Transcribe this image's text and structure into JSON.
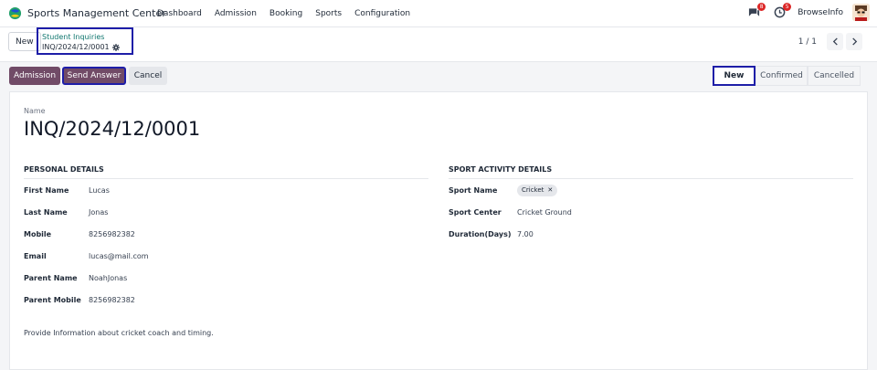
{
  "navbar": {
    "app_name": "Sports Management Center",
    "menu": [
      "Dashboard",
      "Admission",
      "Booking",
      "Sports",
      "Configuration"
    ],
    "chat_badge": "8",
    "activity_badge": "5",
    "company": "BrowseInfo"
  },
  "control": {
    "new_label": "New",
    "breadcrumb_parent": "Student Inquiries",
    "breadcrumb_current": "INQ/2024/12/0001",
    "pager": "1 / 1"
  },
  "actions": {
    "admission": "Admission",
    "send_answer": "Send Answer",
    "cancel": "Cancel"
  },
  "stages": {
    "new": "New",
    "confirmed": "Confirmed",
    "cancelled": "Cancelled"
  },
  "form": {
    "name_caption": "Name",
    "name": "INQ/2024/12/0001",
    "personal": {
      "heading": "PERSONAL DETAILS",
      "first_name_label": "First Name",
      "first_name": "Lucas",
      "last_name_label": "Last Name",
      "last_name": "Jonas",
      "mobile_label": "Mobile",
      "mobile": "8256982382",
      "email_label": "Email",
      "email": "lucas@mail.com",
      "parent_name_label": "Parent Name",
      "parent_name": "NoahJonas",
      "parent_mobile_label": "Parent Mobile",
      "parent_mobile": "8256982382"
    },
    "sport": {
      "heading": "SPORT ACTIVITY DETAILS",
      "sport_name_label": "Sport Name",
      "sport_tag": "Cricket",
      "sport_center_label": "Sport Center",
      "sport_center": "Cricket Ground",
      "duration_label": "Duration(Days)",
      "duration": "7.00"
    },
    "note": "Provide Information about cricket coach and timing."
  }
}
